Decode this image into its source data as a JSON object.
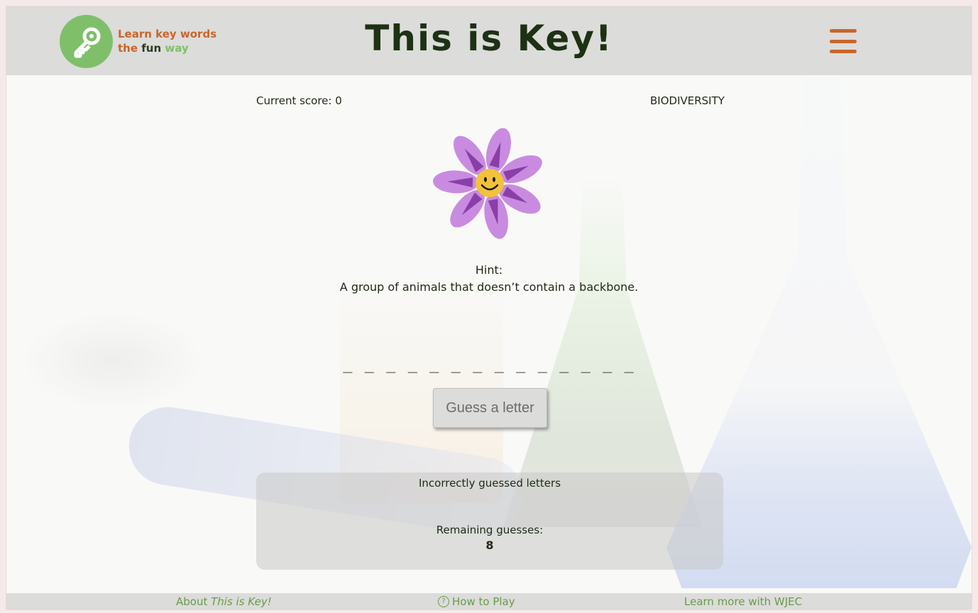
{
  "header": {
    "tagline_line1": "Learn key words",
    "tagline_the": "the",
    "tagline_fun": "fun",
    "tagline_way": "way",
    "title": "This is Key!",
    "logo_icon": "key-icon",
    "menu_icon": "hamburger-menu-icon"
  },
  "game": {
    "score_text": "Current score: 0",
    "topic": "BIODIVERSITY",
    "mascot_icon": "smiling-flower-icon",
    "hint_label": "Hint:",
    "hint_text": "A group of animals that doesn’t contain a backbone.",
    "word_blanks": "_ _ _ _ _ _ _ _ _ _ _ _ _ _",
    "guess_button_label": "Guess a letter",
    "incorrect_label": "Incorrectly guessed letters",
    "remaining_label": "Remaining guesses:",
    "remaining_count": "8"
  },
  "footer": {
    "about_prefix": "About ",
    "about_italic": "This is Key!",
    "how_to_play": "How to Play",
    "learn_more": "Learn more with WJEC",
    "help_icon": "question-circle-icon"
  },
  "colors": {
    "brand_orange": "#c9652a",
    "brand_green": "#7fbf6a",
    "title_dark_green": "#1d3113",
    "header_gray": "#dcdcda"
  }
}
